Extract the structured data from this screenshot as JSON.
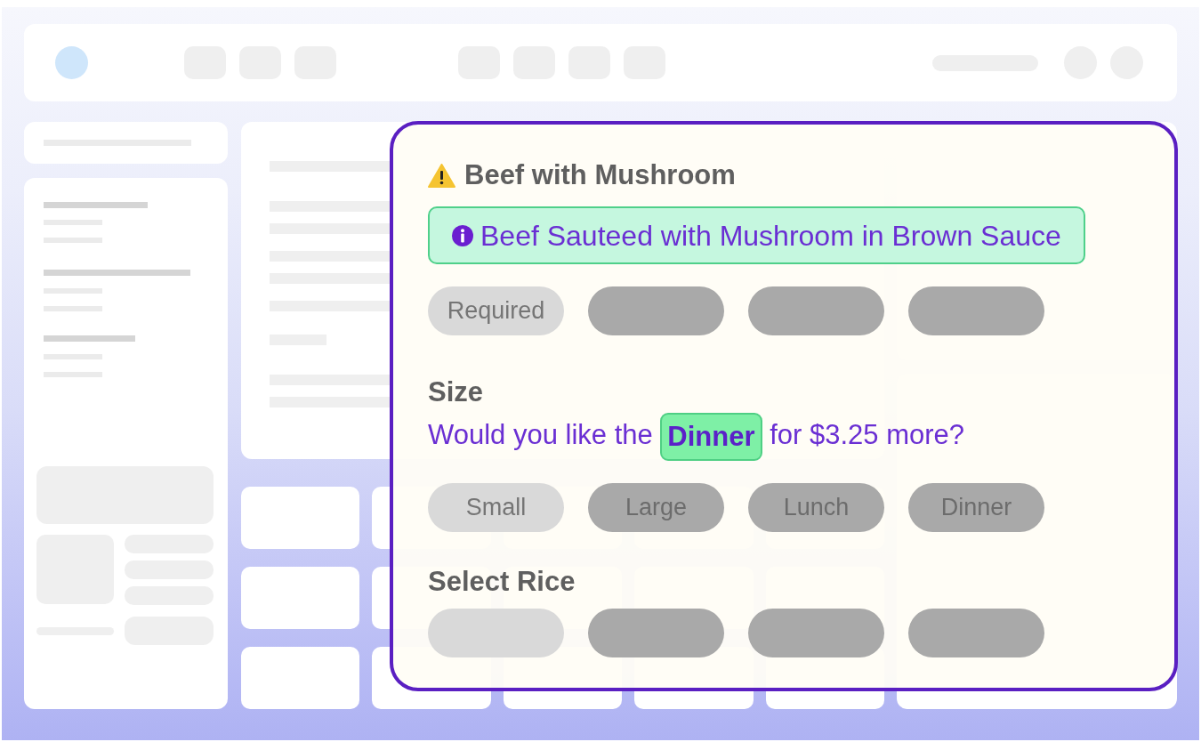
{
  "dialog": {
    "title": "Beef with Mushroom",
    "description": "Beef Sauteed with Mushroom in Brown Sauce",
    "sections": [
      {
        "options": [
          {
            "label": "Required",
            "selected": true
          },
          {
            "selected": false
          },
          {
            "selected": false
          },
          {
            "selected": false
          }
        ]
      },
      {
        "title": "Size",
        "prompt": "Would you like the **Dinner** for $3.25 more?",
        "options": [
          {
            "label": "Small",
            "selected": true
          },
          {
            "label": "Large",
            "selected": false
          },
          {
            "label": "Lunch",
            "selected": false
          },
          {
            "label": "Dinner",
            "selected": false
          }
        ]
      },
      {
        "title": "Select Rice",
        "options": [
          {
            "selected": true
          },
          {
            "selected": false
          },
          {
            "selected": false
          },
          {
            "selected": false
          }
        ]
      }
    ]
  }
}
